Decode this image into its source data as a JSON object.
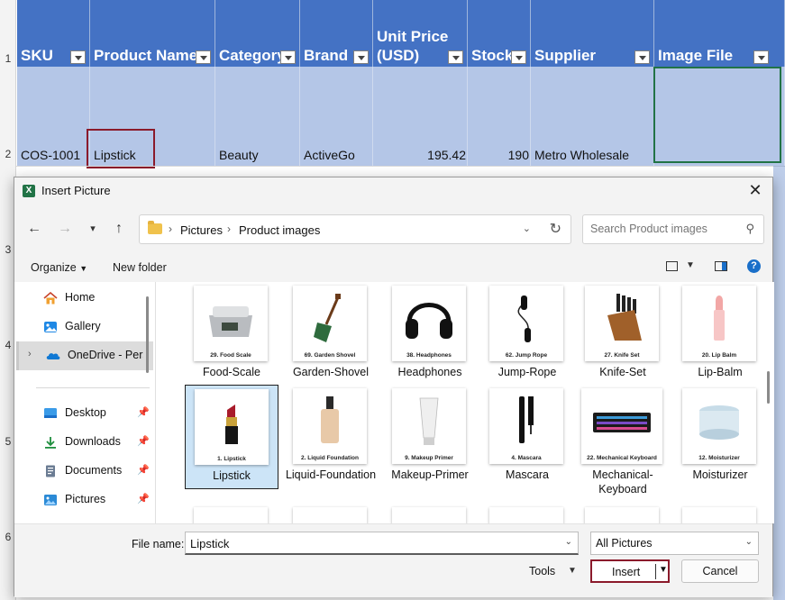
{
  "sheet": {
    "row_numbers": [
      "1",
      "2",
      "3",
      "4",
      "5",
      "6"
    ],
    "headers": [
      "SKU",
      "Product Name",
      "Category",
      "Brand",
      "Unit Price (USD)",
      "Stock",
      "Supplier",
      "Image File"
    ],
    "row2": {
      "sku": "COS-1001",
      "product_name": "Lipstick",
      "category": "Beauty",
      "brand": "ActiveGo",
      "unit_price": "195.42",
      "stock": "190",
      "supplier": "Metro Wholesale",
      "image_file": ""
    },
    "header_color": "#4472c4",
    "row_color": "#b4c6e7"
  },
  "dialog": {
    "title": "Insert Picture",
    "breadcrumb": [
      "Pictures",
      "Product images"
    ],
    "search_placeholder": "Search Product images",
    "commands": {
      "organize": "Organize",
      "new_folder": "New folder"
    },
    "nav_items": [
      {
        "label": "Home",
        "icon": "home-icon"
      },
      {
        "label": "Gallery",
        "icon": "gallery-icon"
      },
      {
        "label": "OneDrive - Perso",
        "icon": "onedrive-icon",
        "selected": true
      },
      {
        "label": "Desktop",
        "icon": "desktop-icon",
        "pinned": true
      },
      {
        "label": "Downloads",
        "icon": "downloads-icon",
        "pinned": true
      },
      {
        "label": "Documents",
        "icon": "documents-icon",
        "pinned": true
      },
      {
        "label": "Pictures",
        "icon": "pictures-icon",
        "pinned": true
      }
    ],
    "files": [
      {
        "label": "Food-Scale",
        "caption": "29. Food Scale"
      },
      {
        "label": "Garden-Shovel",
        "caption": "69. Garden Shovel"
      },
      {
        "label": "Headphones",
        "caption": "38. Headphones"
      },
      {
        "label": "Jump-Rope",
        "caption": "62. Jump Rope"
      },
      {
        "label": "Knife-Set",
        "caption": "27. Knife Set"
      },
      {
        "label": "Lip-Balm",
        "caption": "20. Lip Balm"
      },
      {
        "label": "Lipstick",
        "caption": "1. Lipstick",
        "selected": true
      },
      {
        "label": "Liquid-Foundation",
        "caption": "2. Liquid Foundation"
      },
      {
        "label": "Makeup-Primer",
        "caption": "9. Makeup Primer"
      },
      {
        "label": "Mascara",
        "caption": "4. Mascara"
      },
      {
        "label": "Mechanical-Keyboard",
        "caption": "22. Mechanical Keyboard"
      },
      {
        "label": "Moisturizer",
        "caption": "12. Moisturizer"
      }
    ],
    "footer": {
      "file_name_label": "File name:",
      "file_name_value": "Lipstick",
      "filter": "All Pictures",
      "tools": "Tools",
      "insert": "Insert",
      "cancel": "Cancel"
    }
  }
}
